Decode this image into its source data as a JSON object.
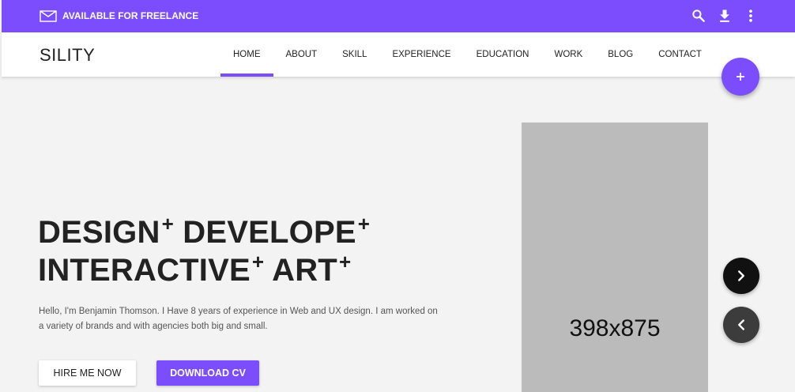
{
  "topbar": {
    "freelance_text": "AVAILABLE FOR FREELANCE",
    "icons": [
      "mail-icon",
      "search-icon",
      "download-icon",
      "more-vert-icon"
    ]
  },
  "nav": {
    "brand": "SILITY",
    "items": [
      {
        "label": "HOME",
        "active": true
      },
      {
        "label": "ABOUT"
      },
      {
        "label": "SKILL"
      },
      {
        "label": "EXPERIENCE"
      },
      {
        "label": "EDUCATION"
      },
      {
        "label": "WORK"
      },
      {
        "label": "BLOG"
      },
      {
        "label": "CONTACT"
      }
    ]
  },
  "fab": {
    "label": "+"
  },
  "hero": {
    "title_words": [
      "DESIGN",
      "DEVELOPE",
      "INTERACTIVE",
      "ART"
    ],
    "plus": "+",
    "description": "Hello, I'm Benjamin Thomson. I Have 8 years of experience in Web and UX design. I am worked on a variety of brands and with agencies both big and small.",
    "hire_label": "HIRE ME NOW",
    "cv_label": "DOWNLOAD CV"
  },
  "image": {
    "placeholder_text": "398x875"
  },
  "colors": {
    "accent": "#7b4dfc",
    "background": "#f3f3f3",
    "placeholder": "#bbbbbb"
  }
}
